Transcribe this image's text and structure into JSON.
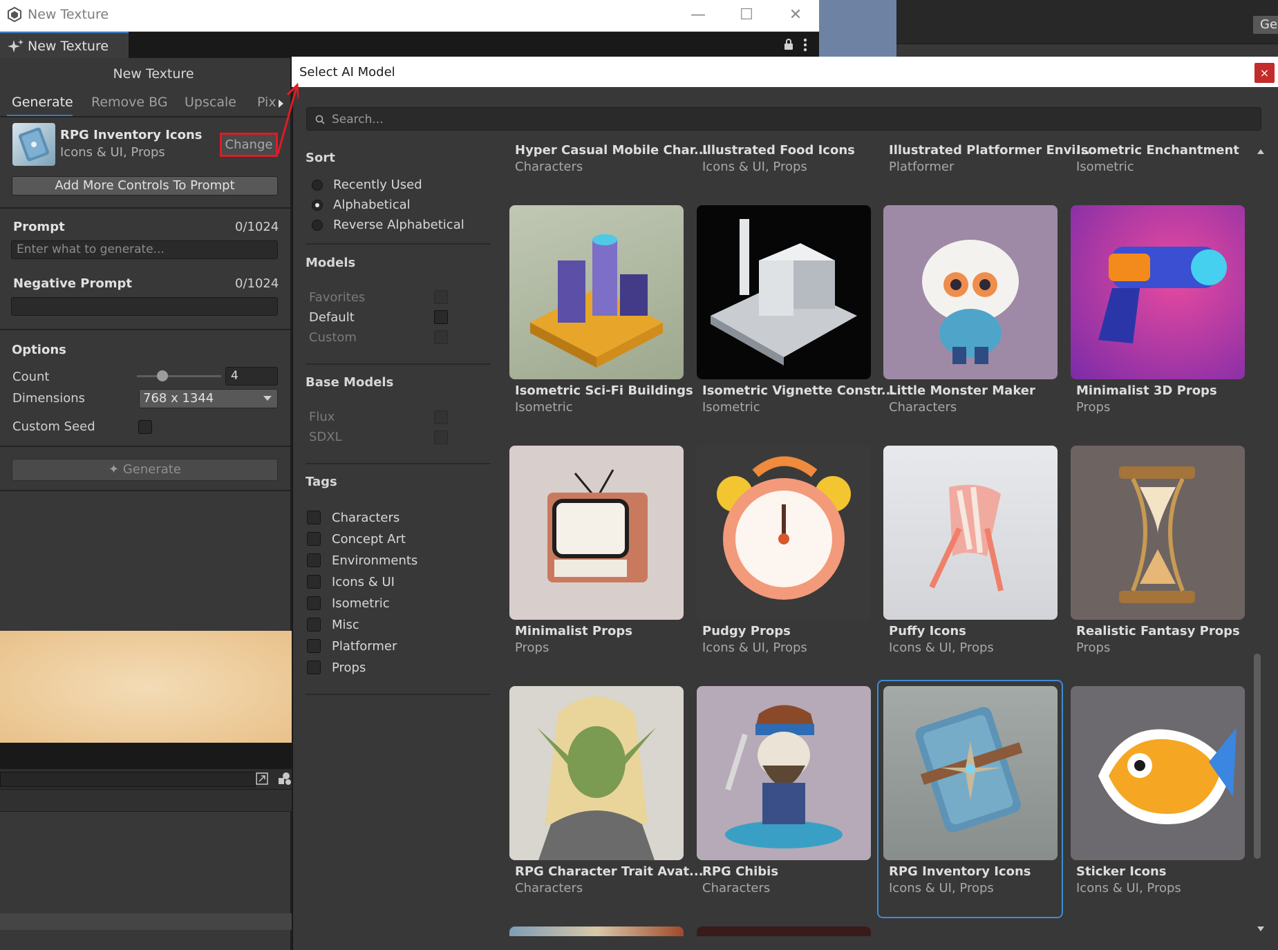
{
  "window": {
    "title": "New Texture",
    "tab": "New Texture",
    "min": "—",
    "max": "☐",
    "close": "✕"
  },
  "right_bg": {
    "button": "Ger"
  },
  "left_panel": {
    "title": "New Texture",
    "tabs": [
      "Generate",
      "Remove BG",
      "Upscale",
      "Pix"
    ],
    "model": {
      "name": "RPG Inventory Icons",
      "tags": "Icons & UI, Props",
      "change_label": "Change"
    },
    "add_more": "Add More Controls To Prompt",
    "prompt": {
      "label": "Prompt",
      "count": "0/1024",
      "placeholder": "Enter what to generate..."
    },
    "negative_prompt": {
      "label": "Negative Prompt",
      "count": "0/1024"
    },
    "options": {
      "header": "Options",
      "count_label": "Count",
      "count_value": "4",
      "count_slider_fraction": 0.3,
      "dimensions_label": "Dimensions",
      "dimensions_value": "768 x 1344",
      "seed_label": "Custom Seed"
    },
    "generate_button": "Generate"
  },
  "modal": {
    "title": "Select AI Model",
    "close": "×",
    "search_placeholder": "Search...",
    "sort": {
      "header": "Sort",
      "options": [
        "Recently Used",
        "Alphabetical",
        "Reverse Alphabetical"
      ],
      "selected": "Alphabetical"
    },
    "models": {
      "header": "Models",
      "items": [
        {
          "label": "Favorites",
          "enabled": false
        },
        {
          "label": "Default",
          "enabled": true
        },
        {
          "label": "Custom",
          "enabled": false
        }
      ]
    },
    "base_models": {
      "header": "Base Models",
      "items": [
        {
          "label": "Flux"
        },
        {
          "label": "SDXL"
        }
      ]
    },
    "tags": {
      "header": "Tags",
      "items": [
        "Characters",
        "Concept Art",
        "Environments",
        "Icons & UI",
        "Isometric",
        "Misc",
        "Platformer",
        "Props"
      ]
    },
    "cards": [
      {
        "name": "Hyper Casual Mobile Char...",
        "category": "Characters"
      },
      {
        "name": "Illustrated Food Icons",
        "category": "Icons & UI, Props"
      },
      {
        "name": "Illustrated Platformer Envi...",
        "category": "Platformer"
      },
      {
        "name": "Isometric Enchantment",
        "category": "Isometric"
      },
      {
        "name": "Isometric Sci-Fi Buildings",
        "category": "Isometric"
      },
      {
        "name": "Isometric Vignette Constr...",
        "category": "Isometric"
      },
      {
        "name": "Little Monster Maker",
        "category": "Characters"
      },
      {
        "name": "Minimalist 3D Props",
        "category": "Props"
      },
      {
        "name": "Minimalist Props",
        "category": "Props"
      },
      {
        "name": "Pudgy Props",
        "category": "Icons & UI, Props"
      },
      {
        "name": "Puffy Icons",
        "category": "Icons & UI, Props"
      },
      {
        "name": "Realistic Fantasy Props",
        "category": "Props"
      },
      {
        "name": "RPG Character Trait Avat...",
        "category": "Characters"
      },
      {
        "name": "RPG Chibis",
        "category": "Characters"
      },
      {
        "name": "RPG Inventory Icons",
        "category": "Icons & UI, Props",
        "selected": true
      },
      {
        "name": "Sticker Icons",
        "category": "Icons & UI, Props"
      }
    ]
  },
  "colors": {
    "accent": "#3d8dd6",
    "highlight": "#e01b24"
  }
}
